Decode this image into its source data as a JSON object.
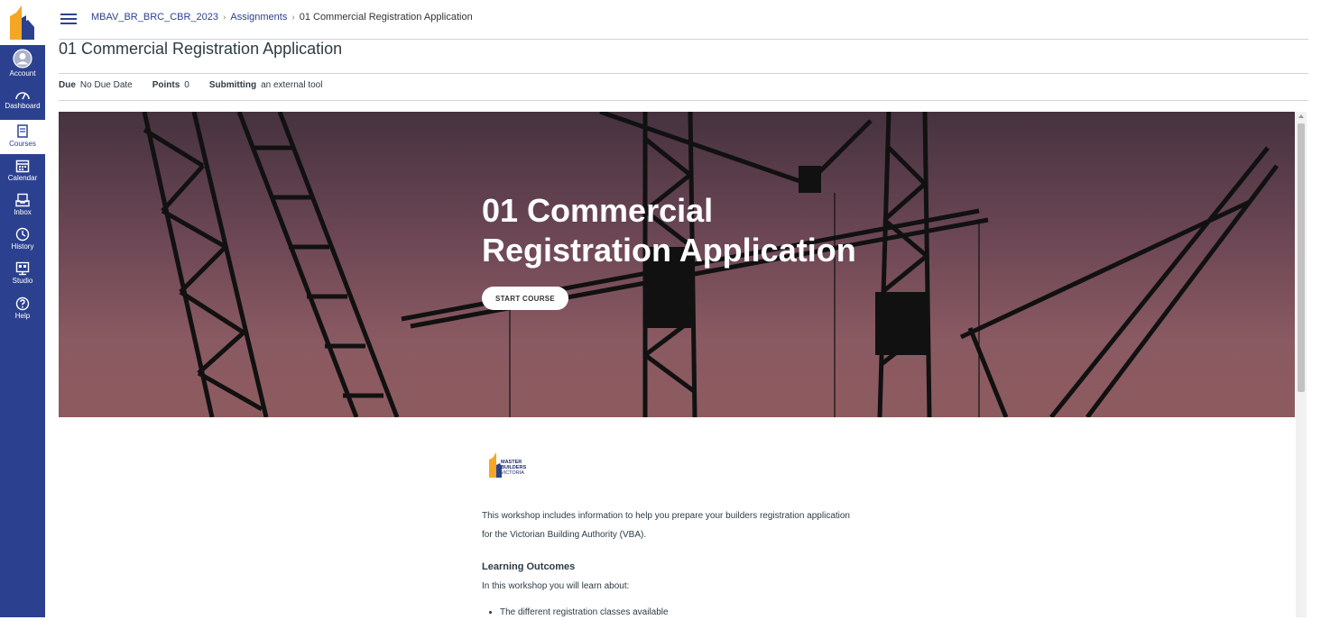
{
  "global_nav": {
    "items": [
      {
        "label": "Account",
        "icon": "account-icon"
      },
      {
        "label": "Dashboard",
        "icon": "dashboard-icon"
      },
      {
        "label": "Courses",
        "icon": "courses-icon"
      },
      {
        "label": "Calendar",
        "icon": "calendar-icon"
      },
      {
        "label": "Inbox",
        "icon": "inbox-icon"
      },
      {
        "label": "History",
        "icon": "history-icon"
      },
      {
        "label": "Studio",
        "icon": "studio-icon"
      },
      {
        "label": "Help",
        "icon": "help-icon"
      }
    ],
    "active": "Courses",
    "colors": {
      "nav_bg": "#2b4190",
      "logo_orange": "#f5a623",
      "logo_navy": "#2b4190"
    }
  },
  "breadcrumb": {
    "course": "MBAV_BR_BRC_CBR_2023",
    "section": "Assignments",
    "current": "01 Commercial Registration Application"
  },
  "assignment": {
    "title": "01 Commercial Registration Application",
    "due_label": "Due",
    "due_value": "No Due Date",
    "points_label": "Points",
    "points_value": "0",
    "submitting_label": "Submitting",
    "submitting_value": "an external tool"
  },
  "hero": {
    "title_line1": "01 Commercial",
    "title_line2": "Registration Application",
    "start_button": "START COURSE"
  },
  "content": {
    "logo_line1": "MASTER",
    "logo_line2": "BUILDERS",
    "logo_line3": "VICTORIA",
    "intro_line1": "This workshop includes information to help you prepare your builders registration application",
    "intro_line2": "for the Victorian Building Authority (VBA).",
    "learning_heading": "Learning Outcomes",
    "learning_intro": "In this workshop you will learn about:",
    "outcomes": [
      "The different registration classes available"
    ]
  }
}
